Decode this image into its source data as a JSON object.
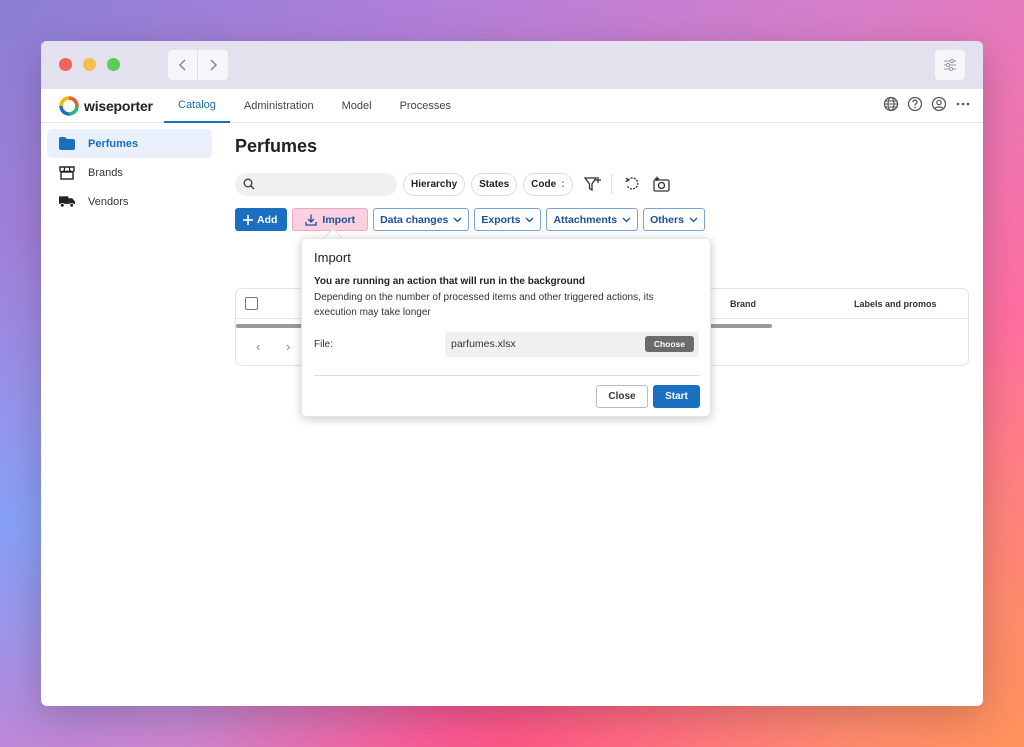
{
  "app": {
    "brand": "wiseporter",
    "tabs": [
      {
        "label": "Catalog",
        "active": true
      },
      {
        "label": "Administration",
        "active": false
      },
      {
        "label": "Model",
        "active": false
      },
      {
        "label": "Processes",
        "active": false
      }
    ],
    "icons": [
      "globe-icon",
      "help-icon",
      "user-icon",
      "more-icon"
    ]
  },
  "sidebar": {
    "items": [
      {
        "label": "Perfumes",
        "icon": "folder-icon",
        "active": true
      },
      {
        "label": "Brands",
        "icon": "store-icon",
        "active": false
      },
      {
        "label": "Vendors",
        "icon": "truck-icon",
        "active": false
      }
    ]
  },
  "main": {
    "title": "Perfumes",
    "search_placeholder": "",
    "filters": [
      "Hierarchy",
      "States",
      "Code"
    ],
    "filter_code_suffix": ":",
    "actions": {
      "add": "Add",
      "import": "Import",
      "dropdowns": [
        "Data changes",
        "Exports",
        "Attachments",
        "Others"
      ]
    },
    "table": {
      "columns": [
        "Brand",
        "Labels and promos"
      ]
    }
  },
  "import_popup": {
    "title": "Import",
    "headline": "You are running an action that will run in the background",
    "description": "Depending on the number of processed items and other triggered actions, its execution may take longer",
    "file_label": "File:",
    "file_value": "parfumes.xlsx",
    "choose_label": "Choose",
    "close_label": "Close",
    "start_label": "Start"
  },
  "colors": {
    "accent": "#1a6fc0",
    "import_highlight": "#fbd0e0"
  }
}
